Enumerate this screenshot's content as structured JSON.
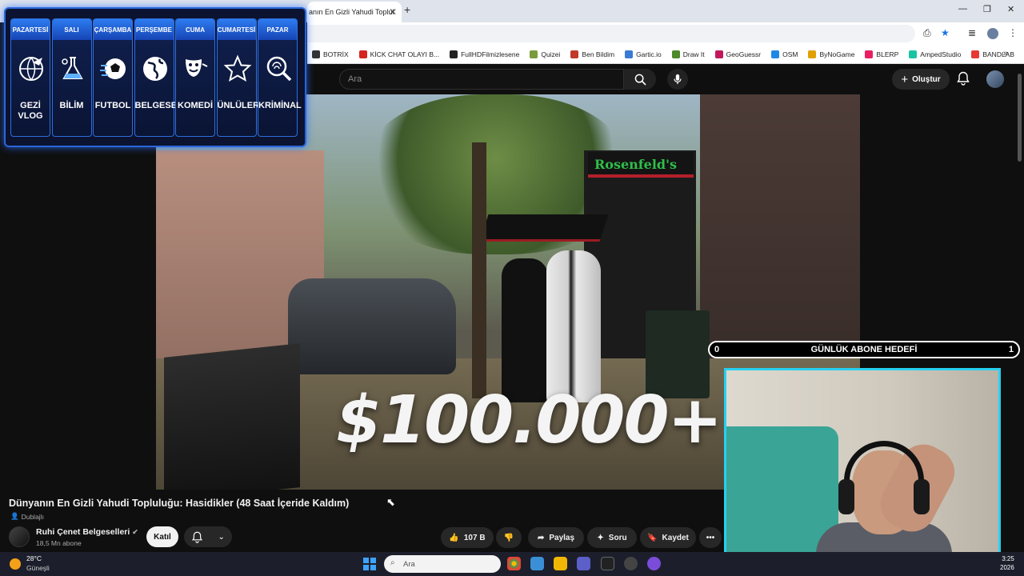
{
  "browser": {
    "tab_title": "anın En Gizli Yahudi Toplul",
    "bookmarks": [
      {
        "label": "BOTRİX",
        "color": "#333333"
      },
      {
        "label": "KİCK CHAT OLAYI B...",
        "color": "#d6241f"
      },
      {
        "label": "FullHDFilmizlesene",
        "color": "#222222"
      },
      {
        "label": "Quizei",
        "color": "#7a9b3c"
      },
      {
        "label": "Ben Bildim",
        "color": "#c0392b"
      },
      {
        "label": "Gartic.io",
        "color": "#3a7bd5"
      },
      {
        "label": "Draw It",
        "color": "#4d8a2a"
      },
      {
        "label": "GeoGuessr",
        "color": "#c2185b"
      },
      {
        "label": "OSM",
        "color": "#1e88e5"
      },
      {
        "label": "ByNoGame",
        "color": "#e0a100"
      },
      {
        "label": "BLERP",
        "color": "#e91e63"
      },
      {
        "label": "AmpedStudio",
        "color": "#1bc4a0"
      },
      {
        "label": "BANDLAB",
        "color": "#e53935"
      }
    ]
  },
  "youtube": {
    "search_placeholder": "Ara",
    "create_label": "Oluştur",
    "video_overlay_text": "$100.000+",
    "shop_sign": "Rosenfeld's",
    "video_title": "Dünyanın En Gizli Yahudi Topluluğu: Hasidikler (48 Saat İçeride Kaldım)",
    "dubbed_label": "Dublajlı",
    "channel_name": "Ruhi Çenet Belgeselleri",
    "channel_subs": "18,5 Mn abone",
    "join_label": "Katıl",
    "like_count": "107 B",
    "share_label": "Paylaş",
    "ask_label": "Soru",
    "save_label": "Kaydet"
  },
  "schedule": {
    "days": [
      {
        "name": "PAZARTESİ",
        "label": "GEZİ VLOG",
        "icon": "globe-plane-icon"
      },
      {
        "name": "SALI",
        "label": "BİLİM",
        "icon": "science-flask-icon"
      },
      {
        "name": "ÇARŞAMBA",
        "label": "FUTBOL",
        "icon": "soccer-ball-icon"
      },
      {
        "name": "PERŞEMBE",
        "label": "BELGESEL",
        "icon": "earth-globe-icon"
      },
      {
        "name": "CUMA",
        "label": "KOMEDİ",
        "icon": "theater-masks-icon"
      },
      {
        "name": "CUMARTESİ",
        "label": "ÜNLÜLER",
        "icon": "star-icon"
      },
      {
        "name": "PAZAR",
        "label": "KRİMİNAL",
        "icon": "magnifier-fingerprint-icon"
      }
    ]
  },
  "goal": {
    "title": "GÜNLÜK ABONE HEDEFİ",
    "current": "0",
    "target": "1"
  },
  "taskbar": {
    "temperature": "28°C",
    "weather": "Güneşli",
    "search_placeholder": "Ara",
    "time": "3:25",
    "date": "2026"
  },
  "colors": {
    "schedule_accent": "#2d7bf0",
    "webcam_border": "#27d0f0",
    "goal_border": "#ffffff"
  }
}
